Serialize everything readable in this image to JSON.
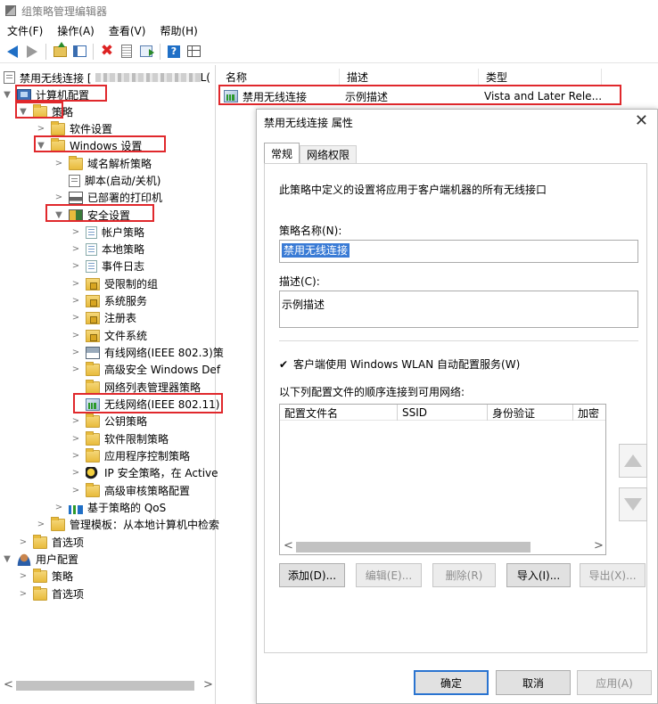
{
  "window": {
    "title": "组策略管理编辑器"
  },
  "menu": [
    "文件(F)",
    "操作(A)",
    "查看(V)",
    "帮助(H)"
  ],
  "tree": {
    "root_label": "禁用无线连接 [",
    "root_suffix": "L(",
    "nodes": {
      "computer_config": "计算机配置",
      "policies": "策略",
      "software_settings": "软件设置",
      "windows_settings": "Windows 设置",
      "dns_policy": "域名解析策略",
      "scripts": "脚本(启动/关机)",
      "deployed_printers": "已部署的打印机",
      "security_settings": "安全设置",
      "account_policies": "帐户策略",
      "local_policies": "本地策略",
      "event_log": "事件日志",
      "restricted_groups": "受限制的组",
      "system_services": "系统服务",
      "registry": "注册表",
      "file_system": "文件系统",
      "wired_network": "有线网络(IEEE 802.3)策",
      "advanced_firewall": "高级安全 Windows Def",
      "network_list": "网络列表管理器策略",
      "wireless_network": "无线网络(IEEE 802.11)",
      "public_key": "公钥策略",
      "software_restriction": "软件限制策略",
      "app_control": "应用程序控制策略",
      "ip_security": "IP 安全策略，在 Active",
      "audit_policy": "高级审核策略配置",
      "qos": "基于策略的 QoS",
      "admin_templates": "管理模板：从本地计算机中检索",
      "preferences": "首选项",
      "user_config": "用户配置",
      "user_policies": "策略",
      "user_preferences": "首选项"
    }
  },
  "list": {
    "columns": [
      "名称",
      "描述",
      "类型"
    ],
    "rows": [
      {
        "name": "禁用无线连接",
        "description": "示例描述",
        "type": "Vista and Later Rele..."
      }
    ]
  },
  "dialog": {
    "title": "禁用无线连接 属性",
    "tabs": [
      "常规",
      "网络权限"
    ],
    "intro": "此策略中定义的设置将应用于客户端机器的所有无线接口",
    "policy_name_label": "策略名称(N):",
    "policy_name_value": "禁用无线连接",
    "description_label": "描述(C):",
    "description_value": "示例描述",
    "checkbox_label": "客户端使用 Windows WLAN 自动配置服务(W)",
    "checkbox_checked": true,
    "order_label": "以下列配置文件的顺序连接到可用网络:",
    "grid_columns": [
      "配置文件名",
      "SSID",
      "身份验证",
      "加密"
    ],
    "buttons": {
      "add": "添加(D)...",
      "edit": "编辑(E)...",
      "delete": "删除(R)",
      "import": "导入(I)...",
      "export": "导出(X)..."
    },
    "footer": {
      "ok": "确定",
      "cancel": "取消",
      "apply": "应用(A)"
    }
  },
  "colors": {
    "highlight_box": "#e0282c",
    "selection": "#3a7bd5"
  }
}
